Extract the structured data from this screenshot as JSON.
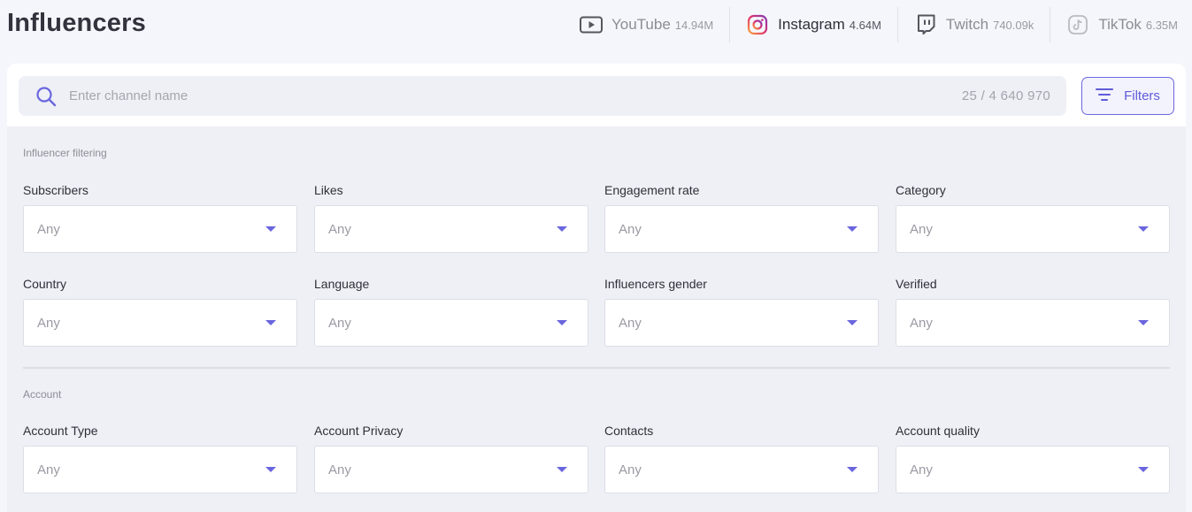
{
  "page": {
    "title": "Influencers"
  },
  "platforms": [
    {
      "name": "YouTube",
      "count": "14.94M",
      "icon": "youtube-icon",
      "active": false
    },
    {
      "name": "Instagram",
      "count": "4.64M",
      "icon": "instagram-icon",
      "active": true
    },
    {
      "name": "Twitch",
      "count": "740.09k",
      "icon": "twitch-icon",
      "active": false
    },
    {
      "name": "TikTok",
      "count": "6.35M",
      "icon": "tiktok-icon",
      "active": false
    }
  ],
  "search": {
    "placeholder": "Enter channel name",
    "value": "",
    "result_count": "25 / 4 640 970",
    "icon": "search-icon"
  },
  "filters_button": {
    "label": "Filters",
    "icon": "filter-lines-icon"
  },
  "sections": [
    {
      "label": "Influencer filtering",
      "fields": [
        {
          "label": "Subscribers",
          "value": "Any"
        },
        {
          "label": "Likes",
          "value": "Any"
        },
        {
          "label": "Engagement rate",
          "value": "Any"
        },
        {
          "label": "Category",
          "value": "Any"
        },
        {
          "label": "Country",
          "value": "Any"
        },
        {
          "label": "Language",
          "value": "Any"
        },
        {
          "label": "Influencers gender",
          "value": "Any"
        },
        {
          "label": "Verified",
          "value": "Any"
        }
      ]
    },
    {
      "label": "Account",
      "fields": [
        {
          "label": "Account Type",
          "value": "Any"
        },
        {
          "label": "Account Privacy",
          "value": "Any"
        },
        {
          "label": "Contacts",
          "value": "Any"
        },
        {
          "label": "Account quality",
          "value": "Any"
        }
      ]
    }
  ],
  "colors": {
    "accent": "#6a66de",
    "background": "#f5f6fb",
    "card": "#eff0f6",
    "instagram_gradient": [
      "#f9a33c",
      "#e1306c",
      "#833ab4"
    ]
  }
}
